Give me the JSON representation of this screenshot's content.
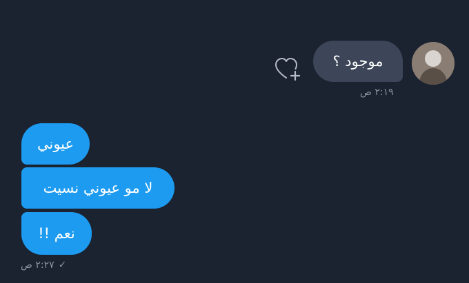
{
  "incoming": {
    "text": "موجود ؟",
    "time": "٢:١٩ ص"
  },
  "outgoing": {
    "messages": [
      "عيوني",
      "لا مو عيوني نسيت",
      "نعم !!"
    ],
    "time": "٢:٢٧ ص",
    "status": "✓"
  },
  "icons": {
    "reaction": "heart-plus-icon",
    "read": "checkmark-icon",
    "avatar": "avatar"
  },
  "colors": {
    "background": "#1b2230",
    "incoming_bubble": "#3c4658",
    "outgoing_bubble": "#1d9bf0",
    "timestamp": "#8a93a3"
  }
}
